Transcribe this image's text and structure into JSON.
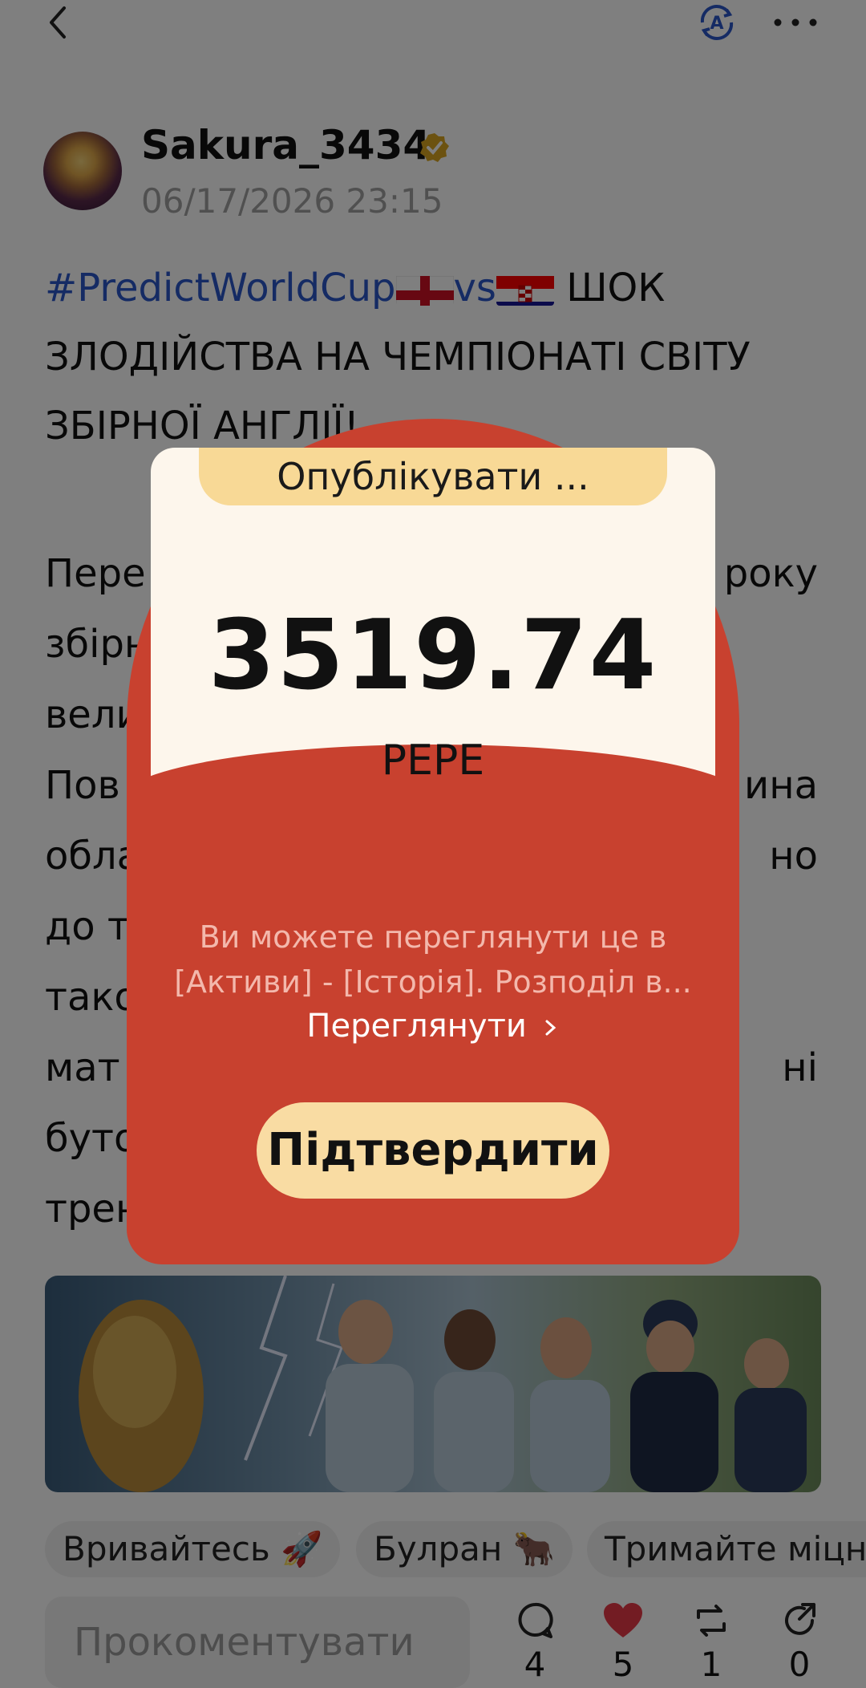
{
  "header": {
    "back_icon": "chevron-left-icon",
    "translate_icon": "translate-icon",
    "more_icon": "more-horizontal-icon"
  },
  "author": {
    "name": "Sakura_3434",
    "verified": true,
    "timestamp": "06/17/2026 23:15"
  },
  "post": {
    "hashtag": "#PredictWorldCup",
    "vs": "vs",
    "title_rest": " ШОК",
    "line2": "ЗЛОДІЙСТВА НА ЧЕМПІОНАТІ СВІТУ",
    "line3": "ЗБІРНОЇ АНГЛІЇ!",
    "body_lines": [
      {
        "left": "Пере",
        "right": "року"
      },
      {
        "left": "збірн",
        "right": ""
      },
      {
        "left": "вели",
        "right": ""
      },
      {
        "left": "Пов",
        "right": "ина"
      },
      {
        "left": "обла",
        "right": "но"
      },
      {
        "left": "до т",
        "right": ""
      },
      {
        "left": "тако",
        "right": ""
      },
      {
        "left": "мат",
        "right": "ні"
      },
      {
        "left": "буто",
        "right": ""
      },
      {
        "left": "трен",
        "right": ""
      }
    ]
  },
  "tags": [
    "Вривайтесь 🚀",
    "Булран 🐂",
    "Тримайте міцно"
  ],
  "footer": {
    "comment_placeholder": "Прокоментувати",
    "comments": "4",
    "likes": "5",
    "reposts": "1",
    "shares": "0"
  },
  "modal": {
    "label": "Опублікувати ...",
    "amount": "3519.74",
    "currency": "PEPE",
    "info": "Ви можете переглянути це в [Активи] - [Історія]. Розподіл в...",
    "view_link": "Переглянути",
    "confirm": "Підтвердити"
  },
  "colors": {
    "modal_red": "#c8412f",
    "card_cream": "#fdf6ec",
    "button_yellow": "#f9dca3",
    "hashtag_blue": "#2b56c8",
    "like_red": "#e63946"
  }
}
